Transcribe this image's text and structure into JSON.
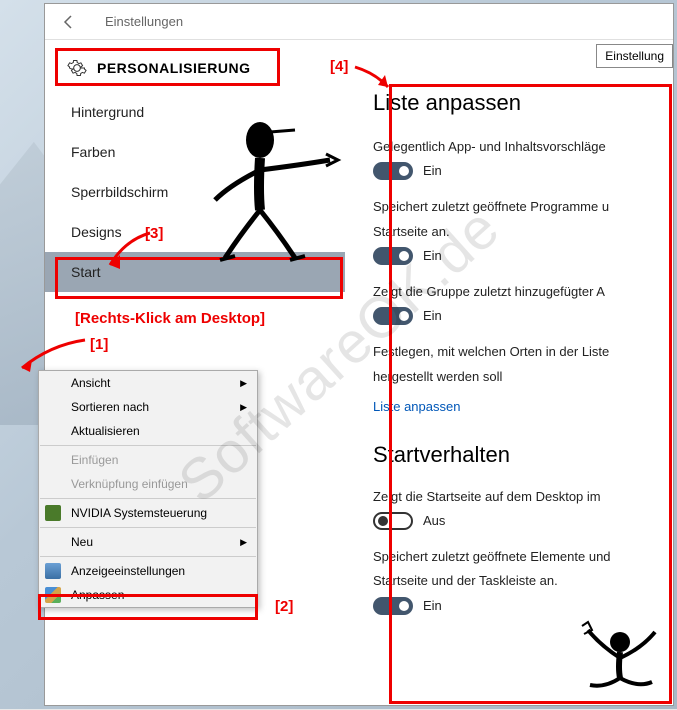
{
  "window": {
    "title": "Einstellungen",
    "tag": "Einstellung"
  },
  "section": {
    "title": "PERSONALISIERUNG"
  },
  "nav": [
    {
      "label": "Hintergrund"
    },
    {
      "label": "Farben"
    },
    {
      "label": "Sperrbildschirm"
    },
    {
      "label": "Designs"
    },
    {
      "label": "Start"
    }
  ],
  "main": {
    "h1": "Liste anpassen",
    "s1": {
      "label": "Gelegentlich App- und Inhaltsvorschläge",
      "state": "Ein"
    },
    "s2": {
      "label": "Speichert zuletzt geöffnete Programme u",
      "label2": "Startseite an.",
      "state": "Ein"
    },
    "s3": {
      "label": "Zeigt die Gruppe zuletzt hinzugefügter A",
      "state": "Ein"
    },
    "s4": {
      "label": "Festlegen, mit welchen Orten in der Liste",
      "label2": "hergestellt werden soll",
      "link": "Liste anpassen"
    },
    "h2": "Startverhalten",
    "s5": {
      "label": "Zeigt die Startseite auf dem Desktop im",
      "state": "Aus"
    },
    "s6": {
      "label": "Speichert zuletzt geöffnete Elemente und",
      "label2": "Startseite und der Taskleiste an.",
      "state": "Ein"
    }
  },
  "context": {
    "items": [
      {
        "label": "Ansicht",
        "sub": true
      },
      {
        "label": "Sortieren nach",
        "sub": true
      },
      {
        "label": "Aktualisieren"
      },
      {
        "sep": true
      },
      {
        "label": "Einfügen",
        "disabled": true
      },
      {
        "label": "Verknüpfung einfügen",
        "disabled": true
      },
      {
        "sep": true
      },
      {
        "label": "NVIDIA Systemsteuerung",
        "icon": "nvidia"
      },
      {
        "sep": true
      },
      {
        "label": "Neu",
        "sub": true
      },
      {
        "sep": true
      },
      {
        "label": "Anzeigeeinstellungen",
        "icon": "display"
      },
      {
        "label": "Anpassen",
        "icon": "personalize"
      }
    ]
  },
  "anno": {
    "a1": "[1]",
    "a1_text": "[Rechts-Klick am Desktop]",
    "a2": "[2]",
    "a3": "[3]",
    "a4": "[4]"
  },
  "watermark": "SoftwareOK.de"
}
